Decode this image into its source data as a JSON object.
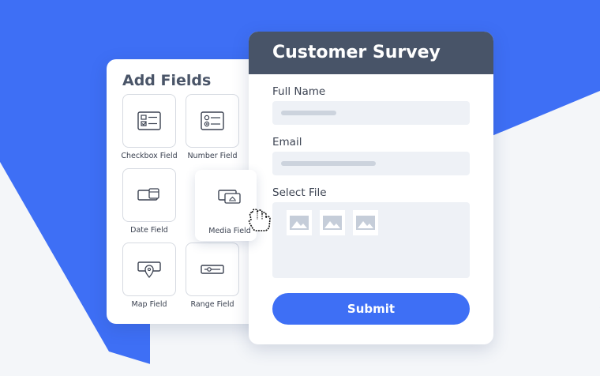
{
  "colors": {
    "background_blue": "#3e6ff5",
    "background_light": "#f4f6f9",
    "header": "#485468",
    "accent": "#3e6ff5"
  },
  "add_fields": {
    "title": "Add Fields",
    "items": [
      {
        "label": "Checkbox Field",
        "icon": "checkbox-list-icon"
      },
      {
        "label": "Number Field",
        "icon": "radio-list-icon"
      },
      {
        "label": "Date Field",
        "icon": "date-icon"
      },
      {
        "label": "Media Field",
        "icon": "media-icon"
      },
      {
        "label": "Map Field",
        "icon": "map-pin-icon"
      },
      {
        "label": "Range Field",
        "icon": "range-slider-icon"
      }
    ]
  },
  "survey": {
    "title": "Customer Survey",
    "fields": [
      {
        "label": "Full Name"
      },
      {
        "label": "Email"
      },
      {
        "label": "Select File"
      }
    ],
    "image_thumbnails": [
      "image-placeholder-icon",
      "image-placeholder-icon",
      "image-placeholder-icon"
    ],
    "submit_label": "Submit"
  },
  "cursor": {
    "icon": "hand-grab-cursor-icon"
  }
}
